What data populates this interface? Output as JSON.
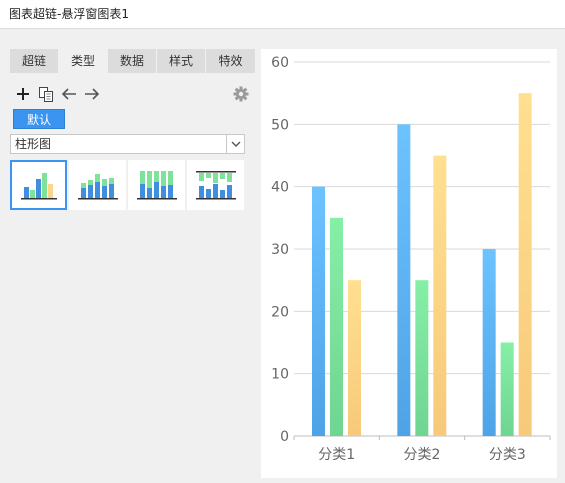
{
  "window": {
    "title": "图表超链-悬浮窗图表1"
  },
  "tabs": [
    {
      "label": "超链",
      "active": false
    },
    {
      "label": "类型",
      "active": true
    },
    {
      "label": "数据",
      "active": false
    },
    {
      "label": "样式",
      "active": false
    },
    {
      "label": "特效",
      "active": false
    }
  ],
  "toolbar": {
    "icons": [
      "add-icon",
      "copy-icon",
      "arrow-left-icon",
      "arrow-right-icon",
      "gear-icon"
    ]
  },
  "default_button": {
    "label": "默认"
  },
  "chart_type_select": {
    "value": "柱形图"
  },
  "thumbnails": [
    {
      "name": "clustered-column",
      "selected": true
    },
    {
      "name": "stacked-column",
      "selected": false
    },
    {
      "name": "percent-stacked-column",
      "selected": false
    },
    {
      "name": "stacked-column-variant",
      "selected": false
    }
  ],
  "colors": {
    "series1": "#5ab4f2",
    "series2": "#7ee29b",
    "series3": "#fbd58a",
    "accent": "#3b95f0"
  },
  "chart_data": {
    "type": "bar",
    "categories": [
      "分类1",
      "分类2",
      "分类3"
    ],
    "series": [
      {
        "values": [
          40,
          50,
          30
        ]
      },
      {
        "values": [
          35,
          25,
          15
        ]
      },
      {
        "values": [
          25,
          45,
          55
        ]
      }
    ],
    "ylim": [
      0,
      60
    ],
    "yticks": [
      "0",
      "10",
      "20",
      "30",
      "40",
      "50",
      "60"
    ],
    "grid": true,
    "legend": "none"
  }
}
